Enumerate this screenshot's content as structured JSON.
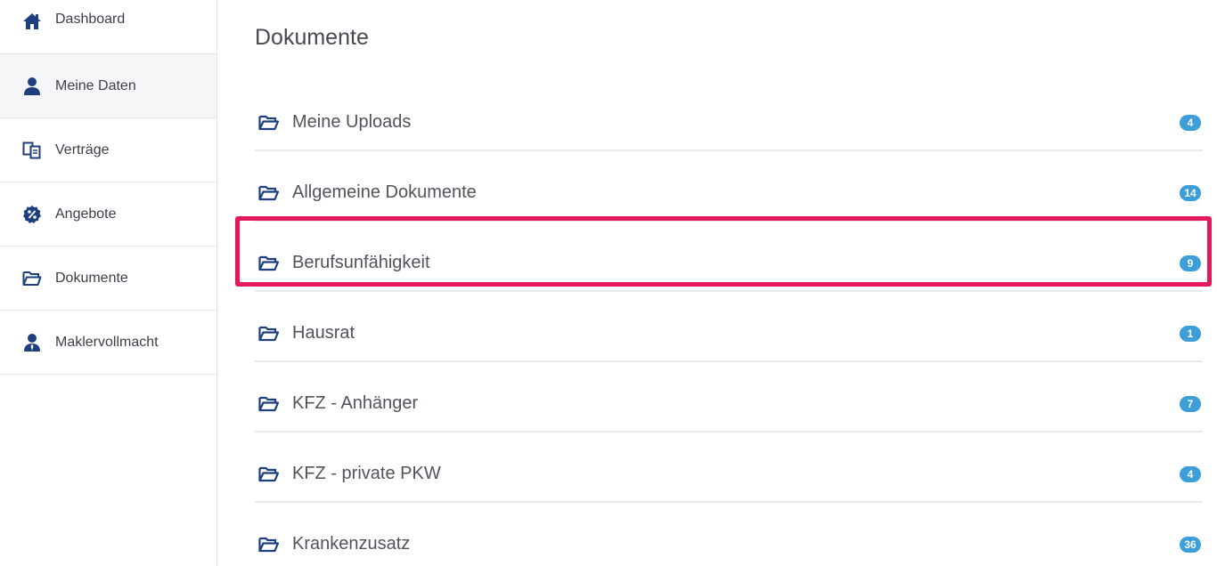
{
  "sidebar": {
    "items": [
      {
        "label": "Dashboard",
        "icon": "home-icon"
      },
      {
        "label": "Meine Daten",
        "icon": "user-icon"
      },
      {
        "label": "Verträge",
        "icon": "documents-icon"
      },
      {
        "label": "Angebote",
        "icon": "percent-icon"
      },
      {
        "label": "Dokumente",
        "icon": "folder-icon"
      },
      {
        "label": "Maklervollmacht",
        "icon": "user-tie-icon"
      }
    ]
  },
  "main": {
    "title": "Dokumente",
    "folders": [
      {
        "label": "Meine Uploads",
        "count": "4"
      },
      {
        "label": "Allgemeine Dokumente",
        "count": "14"
      },
      {
        "label": "Berufsunfähigkeit",
        "count": "9"
      },
      {
        "label": "Hausrat",
        "count": "1"
      },
      {
        "label": "KFZ - Anhänger",
        "count": "7"
      },
      {
        "label": "KFZ - private PKW",
        "count": "4"
      },
      {
        "label": "Krankenzusatz",
        "count": "36"
      }
    ]
  },
  "colors": {
    "icon": "#1d3f7d",
    "badge": "#3e9fd8",
    "highlight": "#e3195c"
  }
}
